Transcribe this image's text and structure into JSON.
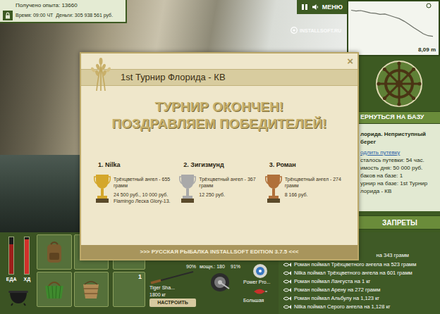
{
  "status": {
    "experience": "Получено опыта: 13660",
    "time": "Время: 09:00 ЧТ",
    "money": "Деньги: 305 938 561 руб."
  },
  "top_menu": {
    "menu": "МЕНЮ"
  },
  "watermark": "INSTALLSOFT.RU",
  "depth_chart": {
    "values": [
      1.2,
      1.4,
      1.3,
      1.6,
      1.9,
      2.0,
      2.3,
      2.2,
      2.6,
      3.0,
      3.4,
      4.1,
      4.9,
      5.8,
      6.6,
      7.4,
      7.9,
      8.09
    ],
    "reading": "8,09 m"
  },
  "base_panel": {
    "return_button": "ЕРНУТЬСЯ НА БАЗУ",
    "location": [
      "лорида. Неприступный",
      "берег"
    ],
    "extend_link": "одлить путевку",
    "info": [
      "сталось путевки: 54 час.",
      "имость дня: 50 000 руб.",
      "баков на базе: 1",
      "урнир на базе: 1st Турнир",
      "лорида - КВ"
    ],
    "bans_button": "ЗАПРЕТЫ"
  },
  "dialog": {
    "title": "1st Турнир Флорида - КВ",
    "close": "×",
    "heading": [
      "ТУРНИР ОКОНЧЕН!",
      "ПОЗДРАВЛЯЕМ ПОБЕДИТЕЛЕЙ!"
    ],
    "winners": [
      {
        "place": "1. Nilka",
        "catch": "Трёхцветный ангел - 655 грамм",
        "prize": "24 500 руб., 10 000 руб. Flamingo Леска Glory-13.",
        "color": "#d4a72c"
      },
      {
        "place": "2. Зигизмунд",
        "catch": "Трёхцветный ангел - 367 грамм",
        "prize": "12 250 руб.",
        "color": "#a9a9a9"
      },
      {
        "place": "3. Роман",
        "catch": "Трёхцветный ангел - 274 грамм",
        "prize": "8 166 руб.",
        "color": "#b0703a"
      }
    ],
    "footer": ">>> РУССКАЯ РЫБАЛКА INSTALLSOFT EDITION 3.7.5 <<<"
  },
  "hud": {
    "meters": [
      {
        "label": "ЕДА",
        "level": 0.8,
        "color": "#9e1f1a"
      },
      {
        "label": "ХД",
        "level": 0.95,
        "color": "#d0302a"
      }
    ],
    "slot_count": "1",
    "rod": {
      "wear": "90%",
      "name": "Tiger Sha...",
      "load": "1800 кг",
      "button": "НАСТРОИТЬ"
    },
    "reel": {
      "power": "мощн.: 180",
      "wear": "91%"
    },
    "line": {
      "name": "Power Pro..."
    },
    "lure": {
      "name": "Большая"
    }
  },
  "log": {
    "cut_line": "на 343 грамм",
    "entries": [
      "Роман поймал Трёхцветного ангела на 523 грамм",
      "Nilka поймал Трёхцветного ангела на 601 грамм",
      "Роман поймал Лангуста на 1 кг",
      "Роман поймал Арену на 272 грамм",
      "Роман поймал Альбулу на 1,123 кг",
      "Nilka поймал Серого ангела на 1,128 кг"
    ]
  }
}
